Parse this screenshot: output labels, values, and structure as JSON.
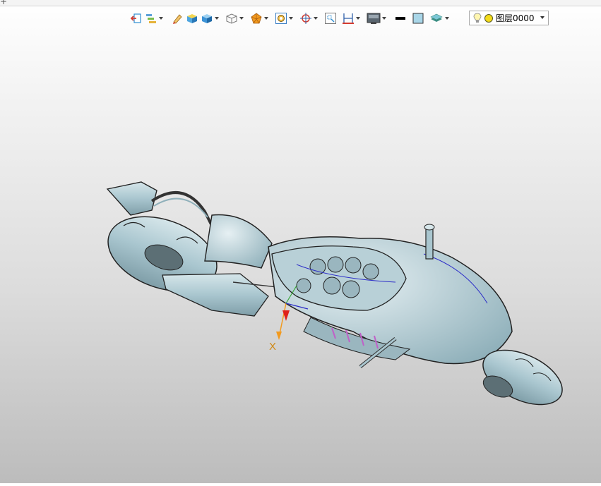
{
  "window": {
    "corner_glyph": "+"
  },
  "toolbar": {
    "buttons": [
      {
        "name": "exit-sketch-icon",
        "has_dropdown": false
      },
      {
        "name": "layer-manager-icon",
        "has_dropdown": true
      },
      {
        "name": "pencil-icon",
        "has_dropdown": false
      },
      {
        "name": "box-cube-icon",
        "has_dropdown": false
      },
      {
        "name": "shaded-cube-icon",
        "has_dropdown": true
      },
      {
        "name": "wireframe-cube-icon",
        "has_dropdown": true
      },
      {
        "name": "section-view-icon",
        "has_dropdown": true
      },
      {
        "name": "zoom-fit-icon",
        "has_dropdown": true
      },
      {
        "name": "snap-target-icon",
        "has_dropdown": true
      },
      {
        "name": "zoom-window-icon",
        "has_dropdown": false
      },
      {
        "name": "measure-icon",
        "has_dropdown": true
      },
      {
        "name": "display-mode-icon",
        "has_dropdown": true
      },
      {
        "name": "line-color-icon",
        "has_dropdown": false
      },
      {
        "name": "fill-color-icon",
        "has_dropdown": false
      },
      {
        "name": "layer-stack-icon",
        "has_dropdown": true
      }
    ],
    "colors": {
      "accent_orange": "#f29a1f",
      "accent_blue": "#2f8ed1",
      "accent_red": "#d43b2f"
    }
  },
  "layer": {
    "current": "图层0000"
  },
  "viewport": {
    "axis_label": "X",
    "model_color": "#a9c6cf",
    "background_top": "#ffffff",
    "background_bottom": "#bcbcbc"
  }
}
